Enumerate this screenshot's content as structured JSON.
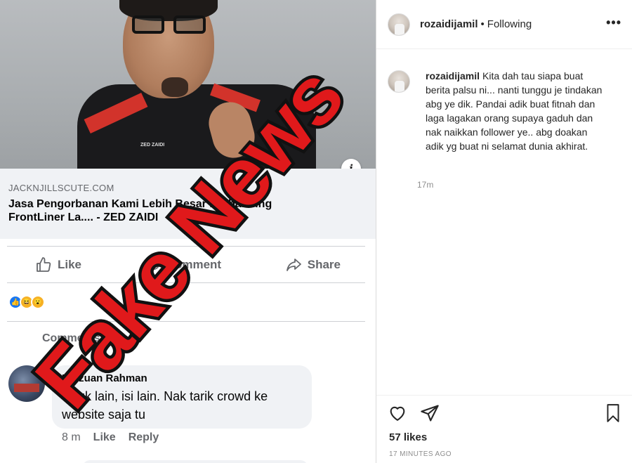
{
  "facebook_post": {
    "link": {
      "domain": "JACKNJILLSCUTE.COM",
      "title": "Jasa Pengorbanan Kami Lebih Besar Berbanding FrontLiner La.... - ZED ZAIDI"
    },
    "shirt_logo": "ZED ZAIDI",
    "actions": {
      "like_label": "Like",
      "comment_label": "Comment",
      "share_label": "Share"
    },
    "comments_label": "Comments",
    "comment": {
      "author": "Ridzuan Rahman",
      "text": "Tajuk lain, isi lain. Nak tarik crowd ke website saja tu",
      "time": "8 m",
      "like_label": "Like",
      "reply_label": "Reply"
    }
  },
  "overlay": {
    "stamp_text": "Fake News",
    "stamp_color": "#e0191b"
  },
  "instagram": {
    "header": {
      "username": "rozaidijamil",
      "separator": "•",
      "follow_status": "Following",
      "more_icon": "more-dots-icon"
    },
    "caption": {
      "username": "rozaidijamil",
      "text": "Kita dah tau siapa buat berita palsu ni... nanti tunggu je tindakan abg ye dik. Pandai adik buat fitnah dan laga lagakan orang supaya gaduh dan nak naikkan follower ye.. abg doakan adik yg buat ni selamat dunia akhirat.",
      "time": "17m"
    },
    "likes": "57 likes",
    "posted_ago": "17 MINUTES AGO"
  }
}
